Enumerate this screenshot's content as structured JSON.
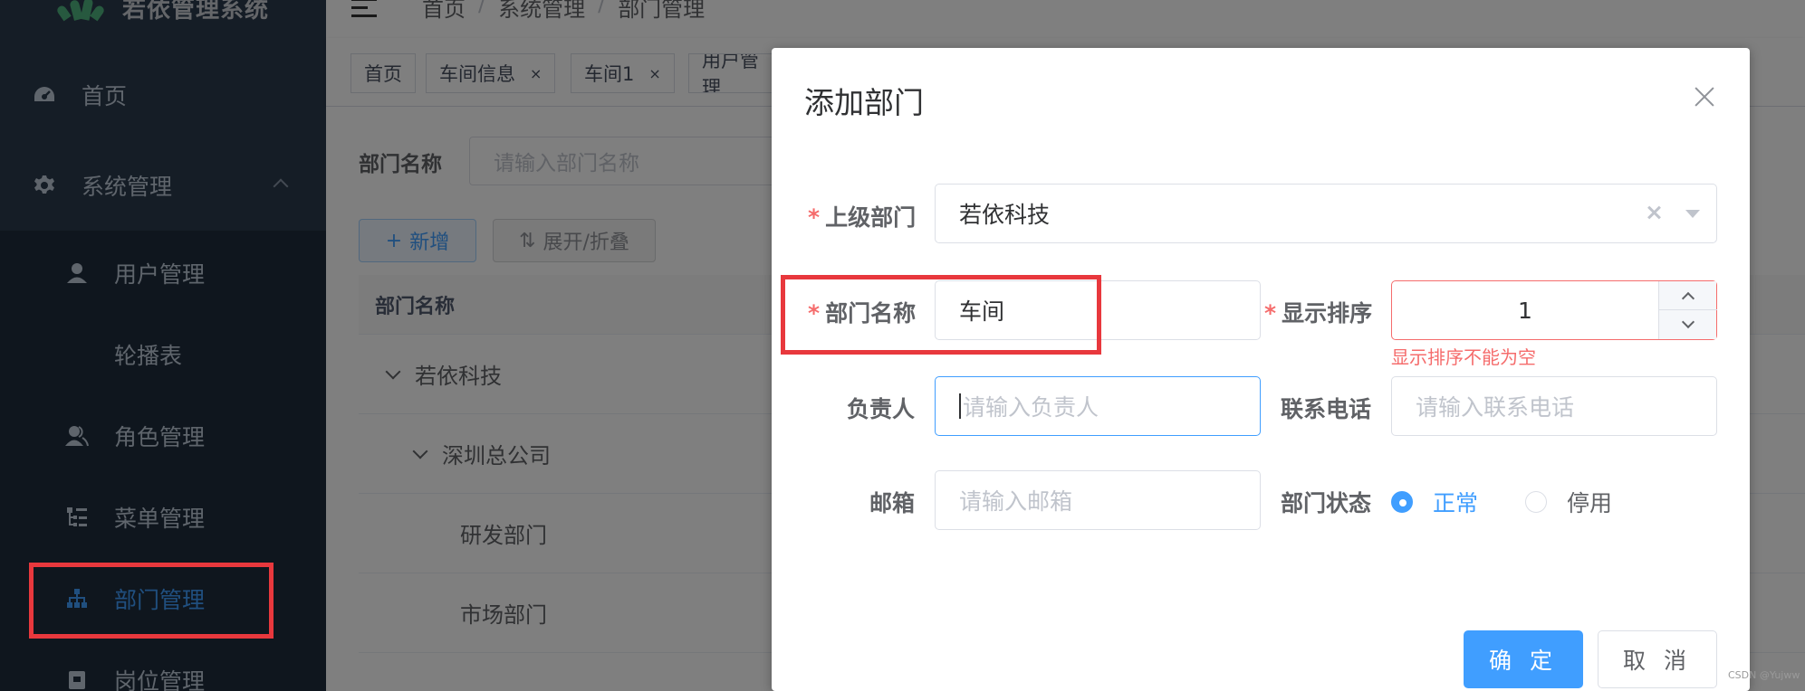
{
  "app": {
    "title": "若依管理系统"
  },
  "sidebar": {
    "items": [
      {
        "label": "首页",
        "icon": "dashboard-icon"
      },
      {
        "label": "系统管理",
        "icon": "gear-icon"
      },
      {
        "label": "用户管理",
        "icon": "user-icon"
      },
      {
        "label": "轮播表",
        "icon": ""
      },
      {
        "label": "角色管理",
        "icon": "peoples-icon"
      },
      {
        "label": "菜单管理",
        "icon": "tree-table-icon"
      },
      {
        "label": "部门管理",
        "icon": "org-tree-icon",
        "active": true
      },
      {
        "label": "岗位管理",
        "icon": "post-icon"
      }
    ]
  },
  "navbar": {
    "breadcrumb": [
      "首页",
      "系统管理",
      "部门管理"
    ],
    "separator": "/"
  },
  "tags": [
    {
      "label": "首页",
      "closable": false
    },
    {
      "label": "车间信息",
      "closable": true
    },
    {
      "label": "车间1",
      "closable": true
    },
    {
      "label": "用户管理",
      "closable": false
    }
  ],
  "tag_close": "×",
  "page": {
    "search_label": "部门名称",
    "search_placeholder": "请输入部门名称",
    "add_button": "新增",
    "add_icon": "+",
    "expand_button": "展开/折叠",
    "expand_icon": "⇅",
    "table_header": "部门名称",
    "rows": [
      "若依科技",
      "深圳总公司",
      "研发部门",
      "市场部门"
    ]
  },
  "dialog": {
    "title": "添加部门",
    "fields": {
      "parent": {
        "label": "上级部门",
        "value": "若依科技"
      },
      "name": {
        "label": "部门名称",
        "value": "车间"
      },
      "order": {
        "label": "显示排序",
        "value": "1",
        "error": "显示排序不能为空"
      },
      "leader": {
        "label": "负责人",
        "placeholder": "请输入负责人"
      },
      "phone": {
        "label": "联系电话",
        "placeholder": "请输入联系电话"
      },
      "email": {
        "label": "邮箱",
        "placeholder": "请输入邮箱"
      },
      "status": {
        "label": "部门状态",
        "options": [
          "正常",
          "停用"
        ],
        "selected": "正常"
      }
    },
    "required_mark": "*",
    "confirm": "确 定",
    "cancel": "取 消"
  },
  "colors": {
    "primary": "#409eff",
    "danger": "#f56c6c",
    "sidebar": "#1f2d3d",
    "highlight": "#e8383d"
  },
  "watermark": "CSDN @Yujww"
}
